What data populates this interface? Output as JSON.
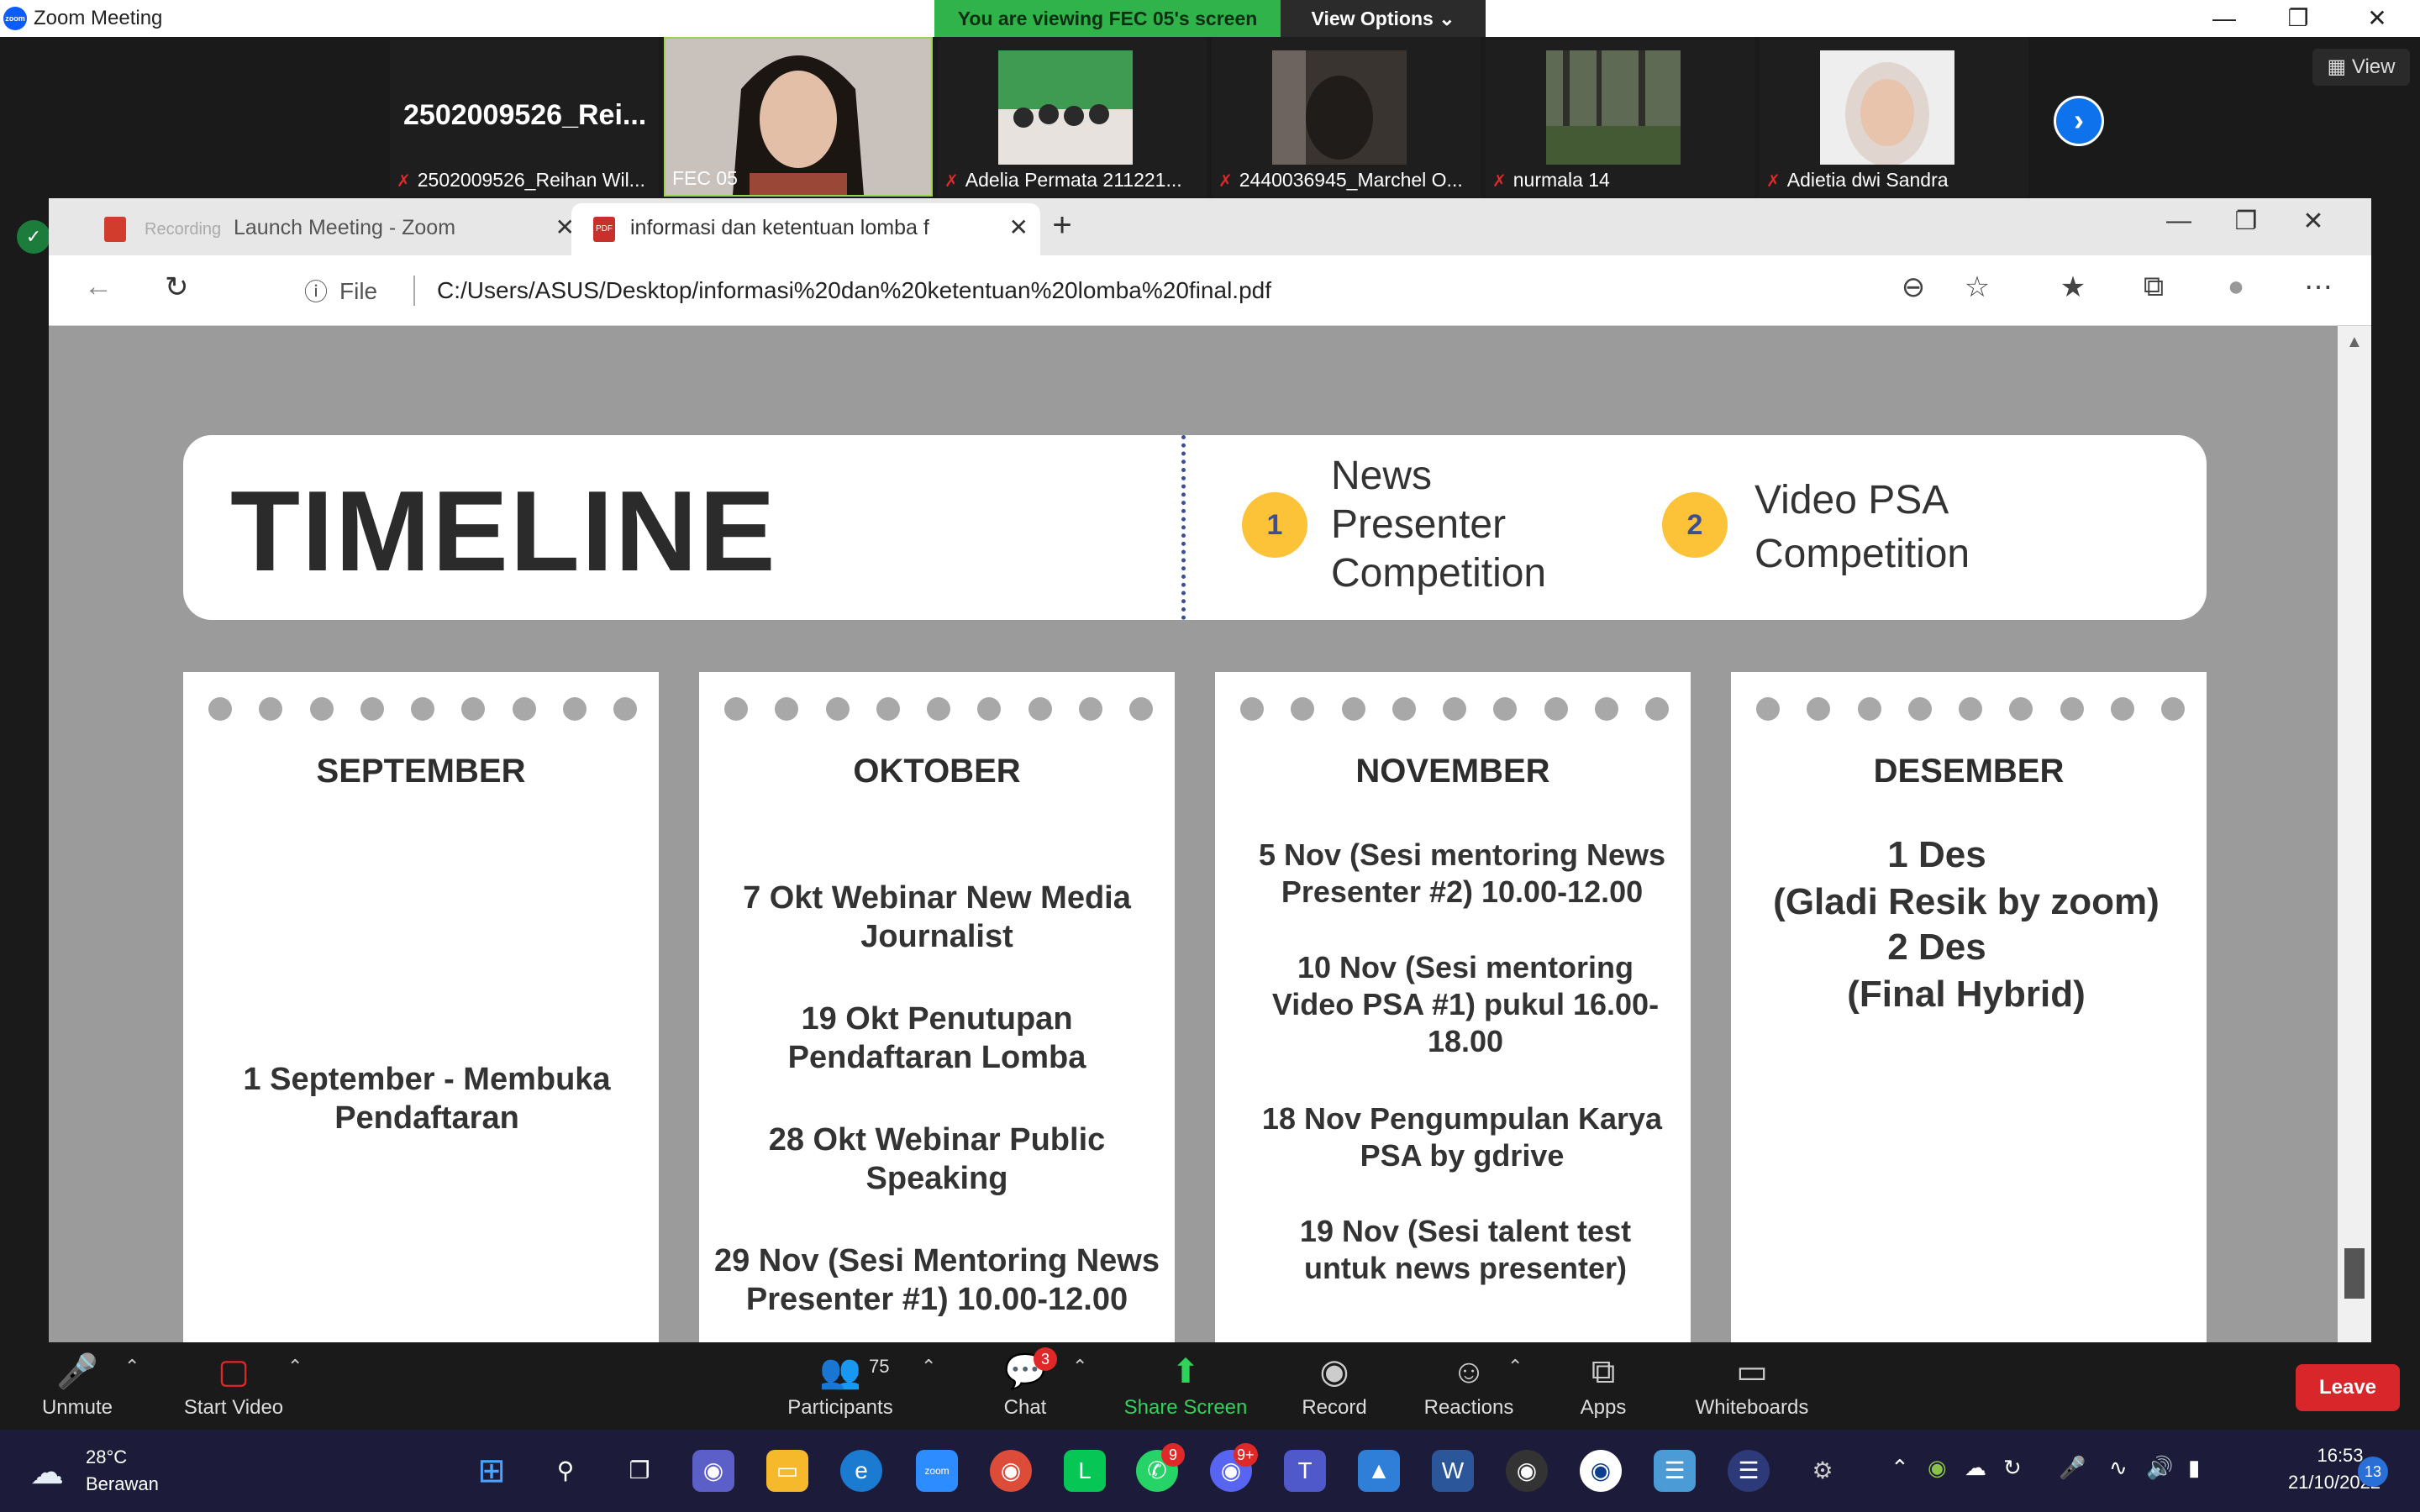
{
  "zoom_window": {
    "title": "Zoom Meeting",
    "share_banner": "You are viewing FEC 05's screen",
    "view_options": "View Options",
    "view_button": "View"
  },
  "participants_strip": {
    "text_tile_name": "2502009526_Rei...",
    "tiles": [
      {
        "label": "2502009526_Reihan Wil..."
      },
      {
        "label": "FEC 05"
      },
      {
        "label": "Adelia Permata 211221..."
      },
      {
        "label": "2440036945_Marchel O..."
      },
      {
        "label": "nurmala 14"
      },
      {
        "label": "Adietia dwi Sandra"
      }
    ]
  },
  "browser": {
    "tabs": [
      {
        "label": "Launch Meeting - Zoom",
        "recording_label": "Recording"
      },
      {
        "label": "informasi dan ketentuan lomba f"
      }
    ],
    "address": {
      "info_label": "File",
      "url": "C:/Users/ASUS/Desktop/informasi%20dan%20ketentuan%20lomba%20final.pdf"
    }
  },
  "pdf": {
    "title": "TIMELINE",
    "competitions": [
      {
        "number": "1",
        "name_lines": [
          "News",
          "Presenter",
          "Competition"
        ]
      },
      {
        "number": "2",
        "name_lines": [
          "Video PSA",
          "Competition"
        ]
      }
    ],
    "months": [
      {
        "name": "SEPTEMBER",
        "events": [
          "1 September - Membuka Pendaftaran"
        ]
      },
      {
        "name": "OKTOBER",
        "events": [
          "7 Okt Webinar New Media Journalist",
          "19 Okt Penutupan Pendaftaran Lomba",
          "28 Okt  Webinar Public Speaking",
          "29 Nov (Sesi Mentoring News Presenter #1) 10.00-12.00"
        ]
      },
      {
        "name": "NOVEMBER",
        "events": [
          "5 Nov (Sesi mentoring News Presenter #2) 10.00-12.00",
          "10 Nov  (Sesi mentoring Video PSA #1) pukul 16.00-18.00",
          "18 Nov Pengumpulan Karya PSA by gdrive",
          "19 Nov (Sesi talent test untuk news presenter)"
        ]
      },
      {
        "name": "DESEMBER",
        "events": [
          "1 Des",
          "(Gladi Resik by zoom)",
          "2 Des",
          "(Final Hybrid)"
        ]
      }
    ]
  },
  "meeting_controls": {
    "unmute": "Unmute",
    "start_video": "Start Video",
    "participants": "Participants",
    "participants_count": "75",
    "chat": "Chat",
    "chat_badge": "3",
    "share_screen": "Share Screen",
    "record": "Record",
    "reactions": "Reactions",
    "apps": "Apps",
    "whiteboards": "Whiteboards",
    "leave": "Leave"
  },
  "taskbar": {
    "weather_temp": "28°C",
    "weather_desc": "Berawan",
    "whatsapp_badge": "9",
    "discord_badge": "9+",
    "time": "16:53",
    "date": "21/10/2022",
    "notifications": "13"
  },
  "colors": {
    "zoom_blue": "#0e72ed",
    "share_green": "#2fb34a",
    "badge_yellow": "#fcc339",
    "divider_navy": "#3d4f93",
    "leave_red": "#d8262a"
  }
}
